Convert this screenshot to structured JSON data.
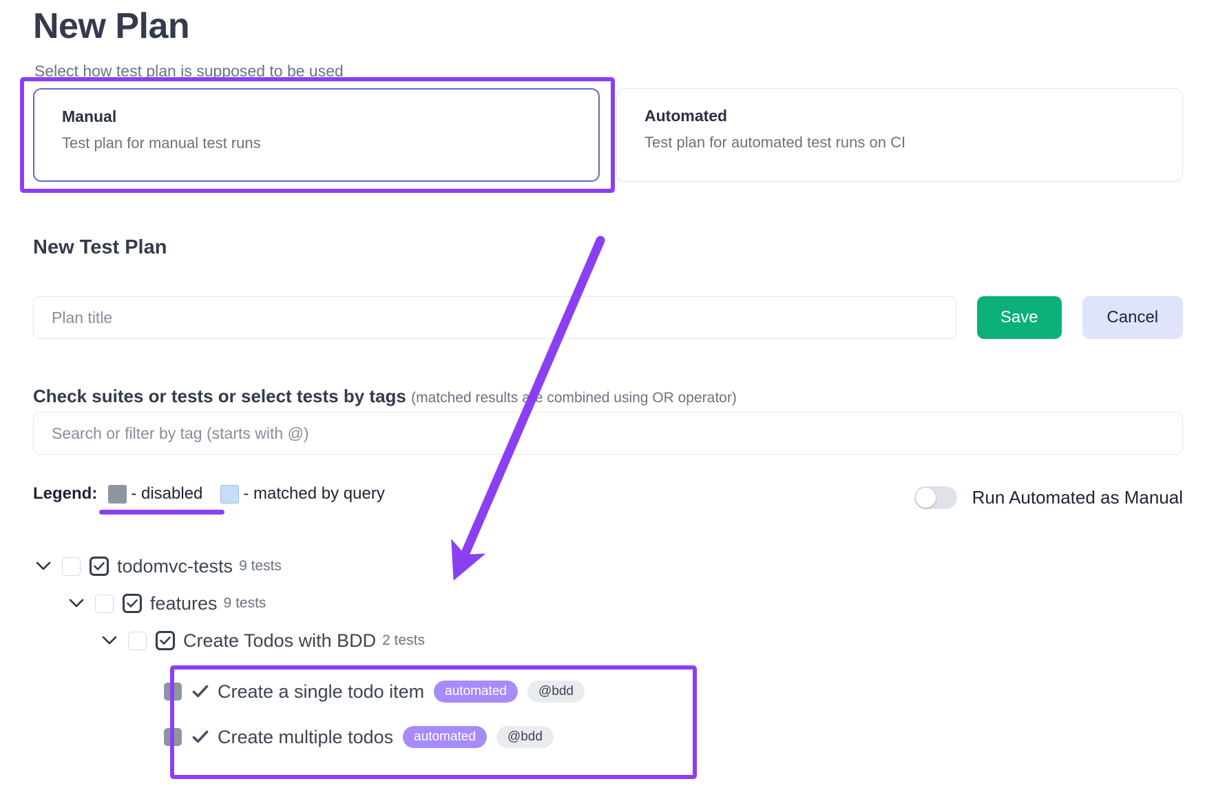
{
  "header": {
    "title": "New Plan",
    "subtitle": "Select how test plan is supposed to be used"
  },
  "mode_cards": [
    {
      "title": "Manual",
      "desc": "Test plan for manual test runs",
      "selected": true
    },
    {
      "title": "Automated",
      "desc": "Test plan for automated test runs on CI",
      "selected": false
    }
  ],
  "form": {
    "section_heading": "New Test Plan",
    "plan_title_placeholder": "Plan title",
    "plan_title_value": "",
    "save_label": "Save",
    "cancel_label": "Cancel"
  },
  "tags": {
    "label": "Check suites or tests or select tests by tags",
    "hint": "(matched results are combined using OR operator)",
    "search_placeholder": "Search or filter by tag (starts with @)",
    "search_value": ""
  },
  "legend": {
    "title": "Legend:",
    "items": [
      {
        "swatch": "disabled",
        "text": "- disabled"
      },
      {
        "swatch": "matched",
        "text": "- matched by query"
      }
    ]
  },
  "toggle": {
    "label": "Run Automated as Manual",
    "state": "off"
  },
  "tree": [
    {
      "label": "todomvc-tests",
      "count": "9 tests",
      "level": 1
    },
    {
      "label": "features",
      "count": "9 tests",
      "level": 2
    },
    {
      "label": "Create Todos with BDD",
      "count": "2 tests",
      "level": 3
    }
  ],
  "tests": [
    {
      "name": "Create a single todo item",
      "badge": "automated",
      "tag": "@bdd"
    },
    {
      "name": "Create multiple todos",
      "badge": "automated",
      "tag": "@bdd"
    }
  ],
  "colors": {
    "annotation_purple": "#8b3ff3",
    "save_green": "#0bb07b",
    "cancel_lavender": "#dfe3fb",
    "badge_purple": "#a78bfa",
    "disabled_gray": "#8d95a3",
    "matched_blue": "#c5ddf6",
    "selected_border": "#6366c9"
  }
}
